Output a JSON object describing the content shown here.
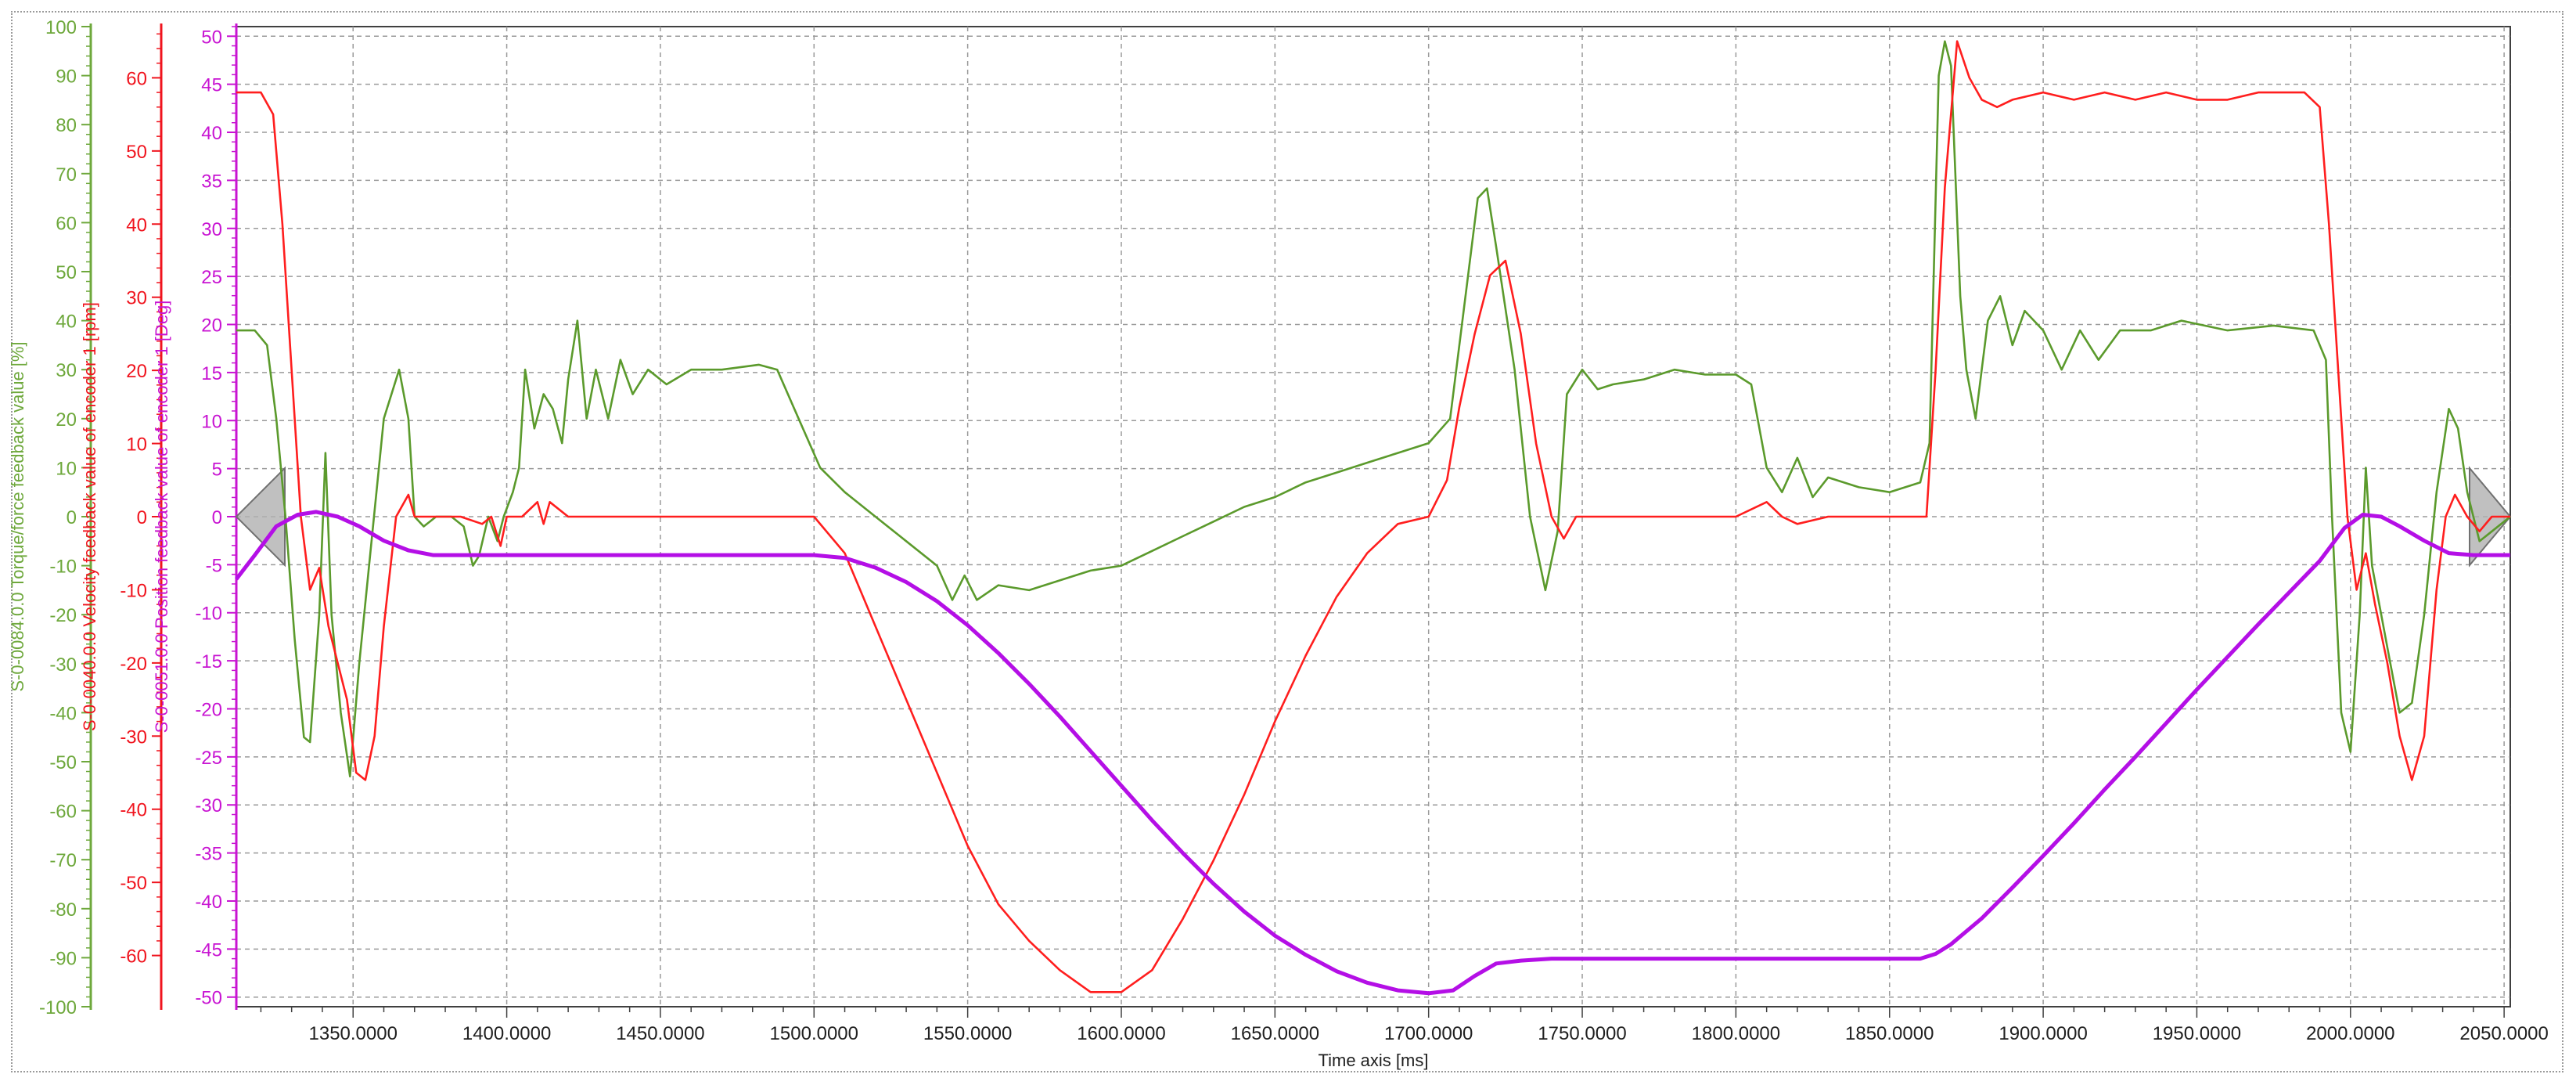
{
  "chart_data": {
    "type": "line",
    "xlabel": "Time axis [ms]",
    "xlim": [
      1312,
      2052
    ],
    "xticks": [
      1350,
      1400,
      1450,
      1500,
      1550,
      1600,
      1650,
      1700,
      1750,
      1800,
      1850,
      1900,
      1950,
      2000,
      2050
    ],
    "xtick_labels": [
      "1350.0000",
      "1400.0000",
      "1450.0000",
      "1500.0000",
      "1550.0000",
      "1600.0000",
      "1650.0000",
      "1700.0000",
      "1750.0000",
      "1800.0000",
      "1850.0000",
      "1900.0000",
      "1950.0000",
      "2000.0000",
      "2050.0000"
    ],
    "grid": true,
    "axes": [
      {
        "id": "torque",
        "label": "S-0-0084.0.0 Torque/force feedback value [%]",
        "color": "#6ea83c",
        "ylim": [
          -100,
          100
        ],
        "step": 10
      },
      {
        "id": "velocity",
        "label": "S-0-0040.0.0 Velocity feedback value of encoder 1 [rpm]",
        "color": "#f0141e",
        "ylim": [
          -67,
          67
        ],
        "step": 10
      },
      {
        "id": "position",
        "label": "S-0-0051.0.0 Position feedback value of encoder 1 [Deg]",
        "color": "#c814d2",
        "ylim": [
          -51,
          51
        ],
        "step": 5
      }
    ],
    "series": [
      {
        "axis": "torque",
        "color": "#5b9a2c",
        "points": [
          [
            1312,
            38
          ],
          [
            1318,
            38
          ],
          [
            1322,
            35
          ],
          [
            1325,
            20
          ],
          [
            1328,
            0
          ],
          [
            1331,
            -25
          ],
          [
            1334,
            -45
          ],
          [
            1336,
            -46
          ],
          [
            1339,
            -20
          ],
          [
            1341,
            13
          ],
          [
            1343,
            -20
          ],
          [
            1346,
            -40
          ],
          [
            1349,
            -53
          ],
          [
            1352,
            -30
          ],
          [
            1356,
            -5
          ],
          [
            1360,
            20
          ],
          [
            1365,
            30
          ],
          [
            1368,
            20
          ],
          [
            1370,
            0
          ],
          [
            1373,
            -2
          ],
          [
            1377,
            0
          ],
          [
            1382,
            0
          ],
          [
            1386,
            -2
          ],
          [
            1389,
            -10
          ],
          [
            1391,
            -8
          ],
          [
            1394,
            0
          ],
          [
            1397,
            -5
          ],
          [
            1399,
            0
          ],
          [
            1402,
            5
          ],
          [
            1404,
            10
          ],
          [
            1406,
            30
          ],
          [
            1409,
            18
          ],
          [
            1412,
            25
          ],
          [
            1415,
            22
          ],
          [
            1418,
            15
          ],
          [
            1420,
            28
          ],
          [
            1423,
            40
          ],
          [
            1426,
            20
          ],
          [
            1429,
            30
          ],
          [
            1433,
            20
          ],
          [
            1437,
            32
          ],
          [
            1441,
            25
          ],
          [
            1446,
            30
          ],
          [
            1452,
            27
          ],
          [
            1460,
            30
          ],
          [
            1470,
            30
          ],
          [
            1482,
            31
          ],
          [
            1488,
            30
          ],
          [
            1495,
            20
          ],
          [
            1502,
            10
          ],
          [
            1510,
            5
          ],
          [
            1520,
            0
          ],
          [
            1530,
            -5
          ],
          [
            1540,
            -10
          ],
          [
            1545,
            -17
          ],
          [
            1549,
            -12
          ],
          [
            1553,
            -17
          ],
          [
            1560,
            -14
          ],
          [
            1570,
            -15
          ],
          [
            1580,
            -13
          ],
          [
            1590,
            -11
          ],
          [
            1600,
            -10
          ],
          [
            1610,
            -7
          ],
          [
            1620,
            -4
          ],
          [
            1630,
            -1
          ],
          [
            1640,
            2
          ],
          [
            1650,
            4
          ],
          [
            1660,
            7
          ],
          [
            1670,
            9
          ],
          [
            1680,
            11
          ],
          [
            1690,
            13
          ],
          [
            1700,
            15
          ],
          [
            1707,
            20
          ],
          [
            1711,
            40
          ],
          [
            1716,
            65
          ],
          [
            1719,
            67
          ],
          [
            1722,
            55
          ],
          [
            1728,
            30
          ],
          [
            1733,
            0
          ],
          [
            1738,
            -15
          ],
          [
            1742,
            -3
          ],
          [
            1745,
            25
          ],
          [
            1750,
            30
          ],
          [
            1755,
            26
          ],
          [
            1760,
            27
          ],
          [
            1770,
            28
          ],
          [
            1780,
            30
          ],
          [
            1790,
            29
          ],
          [
            1800,
            29
          ],
          [
            1805,
            27
          ],
          [
            1810,
            10
          ],
          [
            1815,
            5
          ],
          [
            1820,
            12
          ],
          [
            1825,
            4
          ],
          [
            1830,
            8
          ],
          [
            1840,
            6
          ],
          [
            1850,
            5
          ],
          [
            1860,
            7
          ],
          [
            1863,
            15
          ],
          [
            1866,
            90
          ],
          [
            1868,
            97
          ],
          [
            1870,
            92
          ],
          [
            1873,
            45
          ],
          [
            1875,
            30
          ],
          [
            1878,
            20
          ],
          [
            1882,
            40
          ],
          [
            1886,
            45
          ],
          [
            1890,
            35
          ],
          [
            1894,
            42
          ],
          [
            1900,
            38
          ],
          [
            1906,
            30
          ],
          [
            1912,
            38
          ],
          [
            1918,
            32
          ],
          [
            1925,
            38
          ],
          [
            1935,
            38
          ],
          [
            1945,
            40
          ],
          [
            1960,
            38
          ],
          [
            1975,
            39
          ],
          [
            1988,
            38
          ],
          [
            1992,
            32
          ],
          [
            1994,
            0
          ],
          [
            1997,
            -40
          ],
          [
            2000,
            -48
          ],
          [
            2003,
            -20
          ],
          [
            2005,
            10
          ],
          [
            2007,
            -10
          ],
          [
            2010,
            -20
          ],
          [
            2013,
            -30
          ],
          [
            2016,
            -40
          ],
          [
            2020,
            -38
          ],
          [
            2024,
            -20
          ],
          [
            2028,
            5
          ],
          [
            2032,
            22
          ],
          [
            2035,
            18
          ],
          [
            2038,
            5
          ],
          [
            2042,
            -5
          ],
          [
            2046,
            -3
          ],
          [
            2050,
            -1
          ],
          [
            2052,
            0
          ]
        ]
      },
      {
        "axis": "velocity",
        "color": "#ff1e1e",
        "points": [
          [
            1312,
            58
          ],
          [
            1320,
            58
          ],
          [
            1324,
            55
          ],
          [
            1327,
            40
          ],
          [
            1330,
            20
          ],
          [
            1333,
            0
          ],
          [
            1336,
            -10
          ],
          [
            1339,
            -7
          ],
          [
            1342,
            -15
          ],
          [
            1345,
            -20
          ],
          [
            1348,
            -25
          ],
          [
            1351,
            -35
          ],
          [
            1354,
            -36
          ],
          [
            1357,
            -30
          ],
          [
            1360,
            -15
          ],
          [
            1364,
            0
          ],
          [
            1368,
            3
          ],
          [
            1370,
            0
          ],
          [
            1375,
            0
          ],
          [
            1385,
            0
          ],
          [
            1392,
            -1
          ],
          [
            1395,
            0
          ],
          [
            1398,
            -4
          ],
          [
            1400,
            0
          ],
          [
            1405,
            0
          ],
          [
            1410,
            2
          ],
          [
            1412,
            -1
          ],
          [
            1414,
            2
          ],
          [
            1420,
            0
          ],
          [
            1430,
            0
          ],
          [
            1440,
            0
          ],
          [
            1450,
            0
          ],
          [
            1460,
            0
          ],
          [
            1475,
            0
          ],
          [
            1490,
            0
          ],
          [
            1500,
            0
          ],
          [
            1510,
            -5
          ],
          [
            1520,
            -15
          ],
          [
            1530,
            -25
          ],
          [
            1540,
            -35
          ],
          [
            1550,
            -45
          ],
          [
            1560,
            -53
          ],
          [
            1570,
            -58
          ],
          [
            1580,
            -62
          ],
          [
            1590,
            -65
          ],
          [
            1600,
            -65
          ],
          [
            1610,
            -62
          ],
          [
            1620,
            -55
          ],
          [
            1630,
            -47
          ],
          [
            1640,
            -38
          ],
          [
            1650,
            -28
          ],
          [
            1660,
            -19
          ],
          [
            1670,
            -11
          ],
          [
            1680,
            -5
          ],
          [
            1690,
            -1
          ],
          [
            1700,
            0
          ],
          [
            1706,
            5
          ],
          [
            1710,
            15
          ],
          [
            1715,
            25
          ],
          [
            1720,
            33
          ],
          [
            1725,
            35
          ],
          [
            1730,
            25
          ],
          [
            1735,
            10
          ],
          [
            1740,
            0
          ],
          [
            1744,
            -3
          ],
          [
            1748,
            0
          ],
          [
            1755,
            0
          ],
          [
            1770,
            0
          ],
          [
            1790,
            0
          ],
          [
            1800,
            0
          ],
          [
            1810,
            2
          ],
          [
            1815,
            0
          ],
          [
            1820,
            -1
          ],
          [
            1830,
            0
          ],
          [
            1850,
            0
          ],
          [
            1858,
            0
          ],
          [
            1862,
            0
          ],
          [
            1865,
            20
          ],
          [
            1868,
            45
          ],
          [
            1872,
            65
          ],
          [
            1876,
            60
          ],
          [
            1880,
            57
          ],
          [
            1885,
            56
          ],
          [
            1890,
            57
          ],
          [
            1900,
            58
          ],
          [
            1910,
            57
          ],
          [
            1920,
            58
          ],
          [
            1930,
            57
          ],
          [
            1940,
            58
          ],
          [
            1950,
            57
          ],
          [
            1960,
            57
          ],
          [
            1970,
            58
          ],
          [
            1985,
            58
          ],
          [
            1990,
            56
          ],
          [
            1993,
            40
          ],
          [
            1996,
            20
          ],
          [
            1999,
            0
          ],
          [
            2002,
            -10
          ],
          [
            2005,
            -5
          ],
          [
            2008,
            -12
          ],
          [
            2012,
            -20
          ],
          [
            2016,
            -30
          ],
          [
            2020,
            -36
          ],
          [
            2024,
            -30
          ],
          [
            2028,
            -10
          ],
          [
            2031,
            0
          ],
          [
            2034,
            3
          ],
          [
            2038,
            0
          ],
          [
            2042,
            -2
          ],
          [
            2046,
            0
          ],
          [
            2052,
            0
          ]
        ]
      },
      {
        "axis": "position",
        "color": "#b40fe6",
        "points": [
          [
            1312,
            -6.5
          ],
          [
            1318,
            -4
          ],
          [
            1325,
            -1
          ],
          [
            1332,
            0.2
          ],
          [
            1338,
            0.5
          ],
          [
            1345,
            0
          ],
          [
            1352,
            -1
          ],
          [
            1360,
            -2.5
          ],
          [
            1368,
            -3.5
          ],
          [
            1376,
            -4
          ],
          [
            1400,
            -4
          ],
          [
            1500,
            -4
          ],
          [
            1510,
            -4.3
          ],
          [
            1520,
            -5.3
          ],
          [
            1530,
            -6.8
          ],
          [
            1540,
            -8.8
          ],
          [
            1550,
            -11.3
          ],
          [
            1560,
            -14.2
          ],
          [
            1570,
            -17.4
          ],
          [
            1580,
            -20.8
          ],
          [
            1590,
            -24.4
          ],
          [
            1600,
            -28
          ],
          [
            1610,
            -31.6
          ],
          [
            1620,
            -35
          ],
          [
            1630,
            -38.2
          ],
          [
            1640,
            -41.1
          ],
          [
            1650,
            -43.6
          ],
          [
            1660,
            -45.6
          ],
          [
            1670,
            -47.3
          ],
          [
            1680,
            -48.5
          ],
          [
            1690,
            -49.3
          ],
          [
            1700,
            -49.6
          ],
          [
            1708,
            -49.3
          ],
          [
            1715,
            -47.8
          ],
          [
            1722,
            -46.5
          ],
          [
            1730,
            -46.2
          ],
          [
            1740,
            -46
          ],
          [
            1800,
            -46
          ],
          [
            1860,
            -46
          ],
          [
            1865,
            -45.5
          ],
          [
            1870,
            -44.5
          ],
          [
            1880,
            -41.8
          ],
          [
            1890,
            -38.6
          ],
          [
            1900,
            -35.3
          ],
          [
            1910,
            -31.9
          ],
          [
            1920,
            -28.4
          ],
          [
            1930,
            -25
          ],
          [
            1940,
            -21.5
          ],
          [
            1950,
            -18
          ],
          [
            1960,
            -14.6
          ],
          [
            1970,
            -11.2
          ],
          [
            1980,
            -7.9
          ],
          [
            1990,
            -4.6
          ],
          [
            1998,
            -1.2
          ],
          [
            2004,
            0.2
          ],
          [
            2010,
            0
          ],
          [
            2016,
            -1
          ],
          [
            2024,
            -2.5
          ],
          [
            2032,
            -3.8
          ],
          [
            2040,
            -4
          ],
          [
            2052,
            -4
          ]
        ]
      }
    ],
    "markers": [
      "left-gray-triangle",
      "right-gray-triangle"
    ]
  }
}
